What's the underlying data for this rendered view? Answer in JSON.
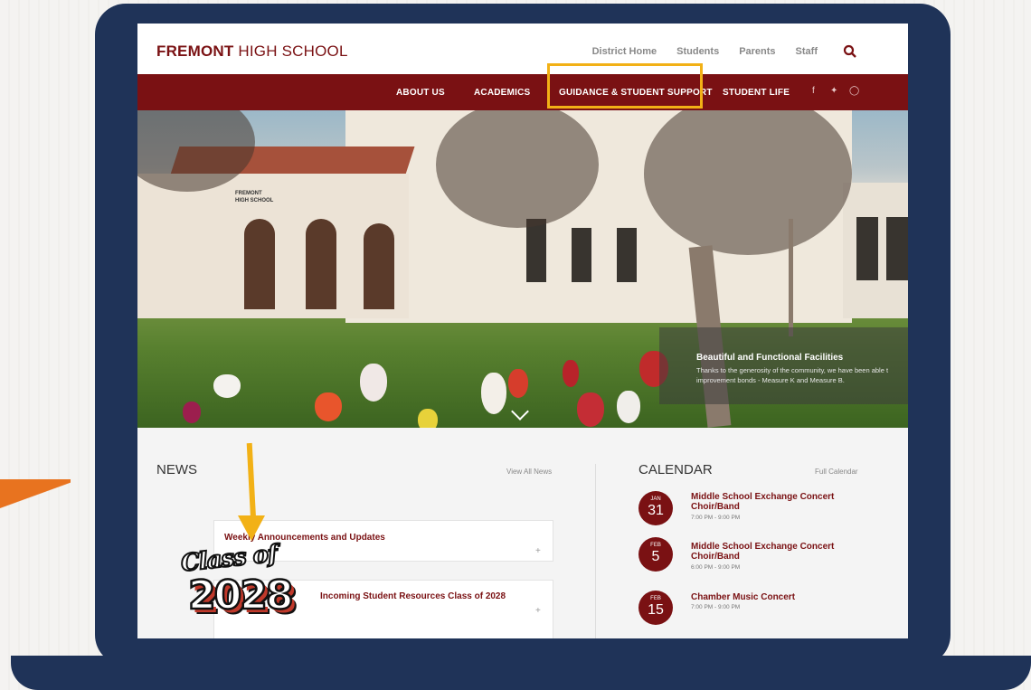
{
  "site": {
    "brand_bold": "FREMONT",
    "brand_rest": " HIGH SCHOOL",
    "top_links": [
      "District Home",
      "Students",
      "Parents",
      "Staff"
    ],
    "nav": [
      "ABOUT US",
      "ACADEMICS",
      "GUIDANCE & STUDENT SUPPORT",
      "STUDENT LIFE"
    ],
    "social": [
      "f",
      "t",
      "o"
    ]
  },
  "hero": {
    "sign_line1": "FREMONT",
    "sign_line2": "HIGH SCHOOL",
    "caption_title": "Beautiful and Functional Facilities",
    "caption_line1": "Thanks to the generosity of the community, we have been able t",
    "caption_line2": "improvement bonds - Measure K and Measure B."
  },
  "news": {
    "title": "NEWS",
    "view_all": "View All News",
    "items": [
      {
        "title": "Weekly Announcements and Updates",
        "expand": "+"
      },
      {
        "title": "Incoming Student Resources Class of 2028",
        "expand": "+"
      }
    ]
  },
  "calendar": {
    "title": "CALENDAR",
    "full": "Full Calendar",
    "events": [
      {
        "month": "JAN",
        "day": "31",
        "title1": "Middle School Exchange Concert",
        "title2": "Choir/Band",
        "time": "7:00 PM - 9:00 PM"
      },
      {
        "month": "FEB",
        "day": "5",
        "title1": "Middle School Exchange Concert",
        "title2": "Choir/Band",
        "time": "6:00 PM - 9:00 PM"
      },
      {
        "month": "FEB",
        "day": "15",
        "title1": "Chamber Music Concert",
        "title2": "",
        "time": "7:00 PM - 9:00 PM"
      }
    ]
  },
  "sticker": {
    "script": "Class of",
    "year": "2028"
  },
  "colors": {
    "maroon": "#7a1113",
    "frame": "#1f3358",
    "highlight": "#f2b116",
    "accent_orange": "#e8731f"
  }
}
